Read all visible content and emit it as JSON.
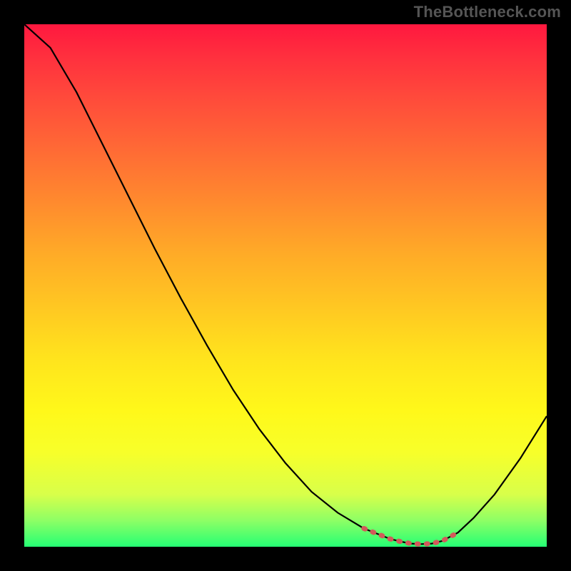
{
  "watermark": "TheBottleneck.com",
  "colors": {
    "background": "#000000",
    "curve": "#000000",
    "dots": "#d25a5a",
    "gradient_top": "#ff183f",
    "gradient_bottom": "#25ff74"
  },
  "chart_data": {
    "type": "line",
    "title": "",
    "xlabel": "",
    "ylabel": "",
    "x": [
      0.0,
      0.05,
      0.1,
      0.15,
      0.2,
      0.25,
      0.3,
      0.35,
      0.4,
      0.45,
      0.5,
      0.55,
      0.6,
      0.65,
      0.7,
      0.72,
      0.74,
      0.76,
      0.78,
      0.8,
      0.83,
      0.86,
      0.9,
      0.95,
      1.0
    ],
    "values": [
      1.0,
      0.955,
      0.87,
      0.77,
      0.67,
      0.57,
      0.475,
      0.385,
      0.3,
      0.225,
      0.16,
      0.105,
      0.065,
      0.035,
      0.015,
      0.01,
      0.006,
      0.005,
      0.006,
      0.011,
      0.027,
      0.055,
      0.1,
      0.17,
      0.25
    ],
    "xlim": [
      0,
      1
    ],
    "ylim": [
      0,
      1
    ],
    "highlight_region": {
      "x_start": 0.65,
      "x_end": 0.83,
      "style": "dotted",
      "color": "#d25a5a"
    },
    "annotations": [],
    "legend": []
  }
}
